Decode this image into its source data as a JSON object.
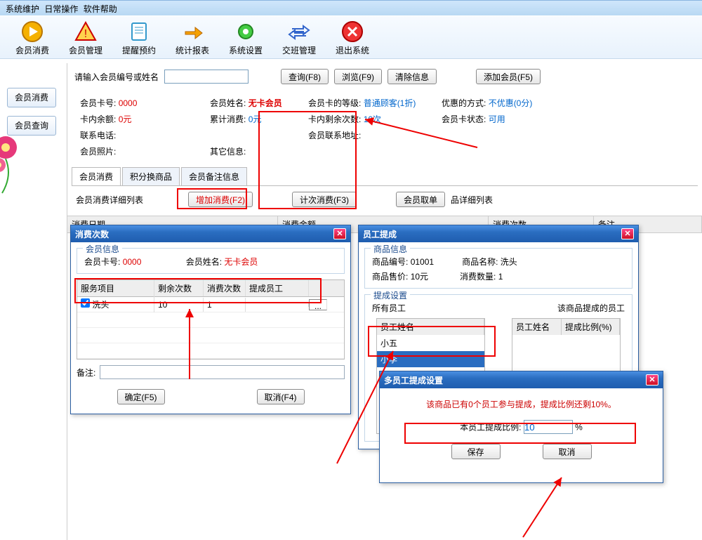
{
  "menu": {
    "items": [
      "系统维护",
      "日常操作",
      "软件帮助"
    ]
  },
  "toolbar": {
    "items": [
      {
        "label": "会员消费"
      },
      {
        "label": "会员管理"
      },
      {
        "label": "提醒预约"
      },
      {
        "label": "统计报表"
      },
      {
        "label": "系统设置"
      },
      {
        "label": "交班管理"
      },
      {
        "label": "退出系统"
      }
    ]
  },
  "side": {
    "consume": "会员消费",
    "query": "会员查询"
  },
  "search": {
    "placeholder": "请输入会员编号或姓名",
    "btn_query": "查询(F8)",
    "btn_browse": "浏览(F9)",
    "btn_clear": "清除信息",
    "btn_add": "添加会员(F5)"
  },
  "member": {
    "card_no_label": "会员卡号:",
    "card_no": "0000",
    "name_label": "会员姓名:",
    "name": "无卡会员",
    "level_label": "会员卡的等级:",
    "level": "普通顾客(1折)",
    "discount_label": "优惠的方式:",
    "discount": "不优惠(0分)",
    "balance_label": "卡内余额:",
    "balance": "0元",
    "total_label": "累计消费:",
    "total": "0元",
    "remain_label": "卡内剩余次数:",
    "remain": "10次",
    "state_label": "会员卡状态:",
    "state": "可用",
    "phone_label": "联系电话:",
    "addr_label": "会员联系地址:",
    "photo_label": "会员照片:",
    "other_label": "其它信息:"
  },
  "tabs": {
    "a": "会员消费",
    "b": "积分换商品",
    "c": "会员备注信息"
  },
  "detail": {
    "label": "会员消费详细列表",
    "btn_add": "增加消费(F2)",
    "btn_count": "计次消费(F3)",
    "btn_pull": "会员取单",
    "tail": "品详细列表",
    "cols": {
      "date": "消费日期",
      "amount": "消费金额",
      "times": "消费次数",
      "note": "备注"
    }
  },
  "dlg1": {
    "title": "消费次数",
    "info_legend": "会员信息",
    "card_no_label": "会员卡号:",
    "card_no": "0000",
    "name_label": "会员姓名:",
    "name": "无卡会员",
    "cols": {
      "svc": "服务项目",
      "rem": "剩余次数",
      "use": "消费次数",
      "emp": "提成员工"
    },
    "row": {
      "svc": "洗头",
      "rem": "10",
      "use": "1"
    },
    "remark_label": "备注:",
    "ok": "确定(F5)",
    "cancel": "取消(F4)"
  },
  "dlg2": {
    "title": "员工提成",
    "prod_legend": "商品信息",
    "sku_label": "商品编号:",
    "sku": "01001",
    "pname_label": "商品名称:",
    "pname": "洗头",
    "price_label": "商品售价:",
    "price": "10元",
    "qty_label": "消费数量:",
    "qty": "1",
    "set_legend": "提成设置",
    "all_label": "所有员工",
    "sel_label": "该商品提成的员工",
    "col_name": "员工姓名",
    "col_rate": "提成比例(%)",
    "emps": [
      "小五",
      "小李"
    ]
  },
  "dlg3": {
    "title": "多员工提成设置",
    "tip": "该商品已有0个员工参与提成，提成比例还剩10%。",
    "rate_label": "本员工提成比例:",
    "rate_value": "10",
    "pct": "%",
    "save": "保存",
    "cancel": "取消"
  }
}
